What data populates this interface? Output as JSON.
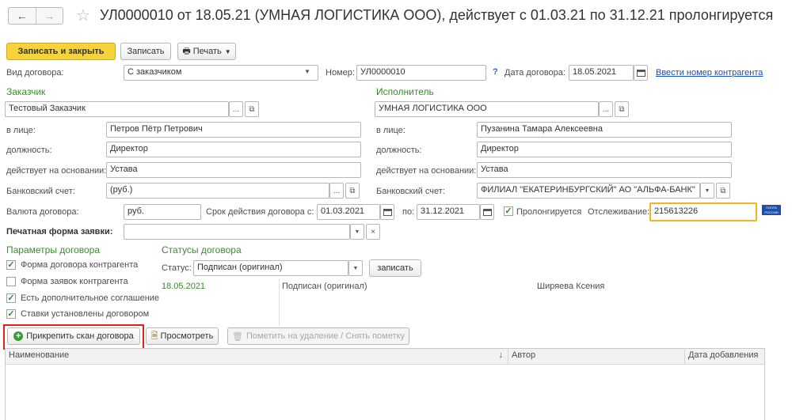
{
  "title": "УЛ0000010 от 18.05.21 (УМНАЯ ЛОГИСТИКА ООО), действует с 01.03.21 по 31.12.21 пролонгируется",
  "toolbar": {
    "save_close": "Записать и закрыть",
    "save": "Записать",
    "print": "Печать"
  },
  "header": {
    "contract_type_label": "Вид договора:",
    "contract_type_value": "С заказчиком",
    "number_label": "Номер:",
    "number_value": "УЛ0000010",
    "help": "?",
    "date_label": "Дата договора:",
    "date_value": "18.05.2021",
    "enter_counterparty_number": "Ввести номер контрагента"
  },
  "customer": {
    "section": "Заказчик",
    "name": "Тестовый Заказчик",
    "person_label": "в лице:",
    "person": "Петров Пётр Петрович",
    "position_label": "должность:",
    "position": "Директор",
    "basis_label": "действует на основании:",
    "basis": "Устава",
    "bank_label": "Банковский счет:",
    "bank": "(руб.)"
  },
  "contractor": {
    "section": "Исполнитель",
    "name": "УМНАЯ ЛОГИСТИКА ООО",
    "person_label": "в лице:",
    "person": "Пузанина Тамара Алексеевна",
    "position_label": "должность:",
    "position": "Директор",
    "basis_label": "действует на основании:",
    "basis": "Устава",
    "bank_label": "Банковский счет:",
    "bank": "ФИЛИАЛ \"ЕКАТЕРИНБУРГСКИЙ\" АО \"АЛЬФА-БАНК\""
  },
  "terms": {
    "currency_label": "Валюта договора:",
    "currency": "руб.",
    "validity_label": "Срок действия договора с:",
    "date_from": "01.03.2021",
    "to_label": "по:",
    "date_to": "31.12.2021",
    "prolong_label": "Пролонгируется",
    "tracking_label": "Отслеживание:",
    "tracking_value": "215613226",
    "post_logo": "ПОЧТА РОССИИ"
  },
  "print_form_label": "Печатная форма заявки:",
  "params": {
    "section": "Параметры договора",
    "items": [
      {
        "label": "Форма договора контрагента",
        "checked": true
      },
      {
        "label": "Форма заявок контрагента",
        "checked": false
      },
      {
        "label": "Есть дополнительное соглашение",
        "checked": true
      },
      {
        "label": "Ставки установлены договором",
        "checked": true
      }
    ]
  },
  "statuses": {
    "section": "Статусы договора",
    "status_label": "Статус:",
    "status_value": "Подписан (оригинал)",
    "save_btn": "записать",
    "history_date": "18.05.2021",
    "history_status": "Подписан (оригинал)",
    "history_author": "Ширяева Ксения"
  },
  "attachments": {
    "attach_btn": "Прикрепить скан договора",
    "view_btn": "Просмотреть",
    "mark_btn": "Пометить на удаление / Снять пометку",
    "columns": [
      "Наименование",
      "Автор",
      "Дата добавления"
    ]
  },
  "colors": {
    "accent_yellow": "#f6d33c",
    "highlight_red": "#e0201b",
    "section_green": "#3b8b30",
    "tracking_border": "#f0b323"
  }
}
